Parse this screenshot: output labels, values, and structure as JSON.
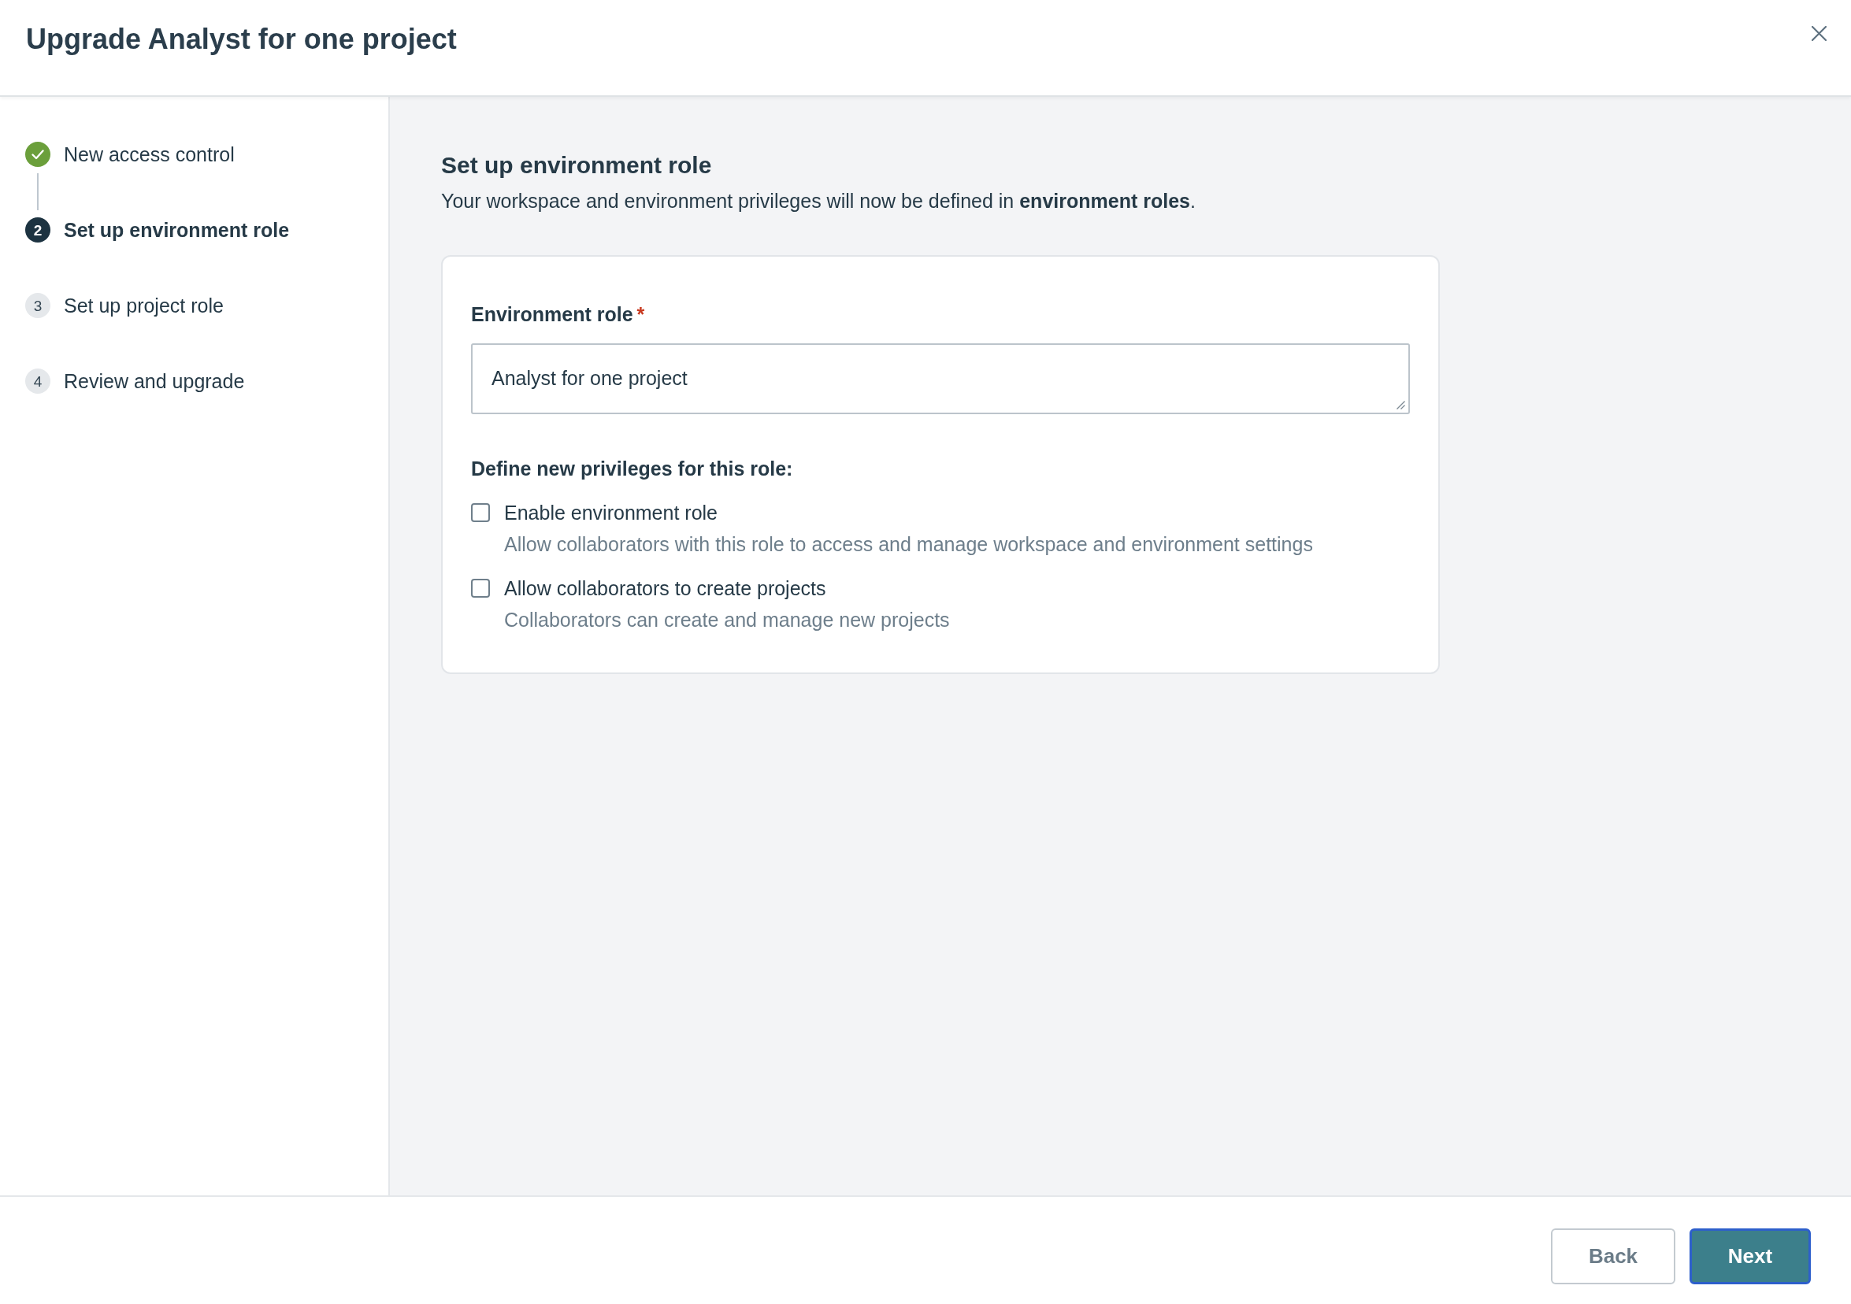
{
  "dialog": {
    "title": "Upgrade Analyst for one project"
  },
  "steps": [
    {
      "label": "New access control",
      "completed": true,
      "selected": false
    },
    {
      "number": "2",
      "label": "Set up environment role",
      "completed": false,
      "selected": true
    },
    {
      "number": "3",
      "label": "Set up project role",
      "completed": false,
      "selected": false
    },
    {
      "number": "4",
      "label": "Review and upgrade",
      "completed": false,
      "selected": false
    }
  ],
  "section": {
    "heading": "Set up environment role",
    "description": "Your workspace and environment privileges will now be defined in **environment roles**."
  },
  "form": {
    "role_field": {
      "label": "Environment role",
      "required_mark": "*",
      "value": "Analyst for one project"
    },
    "privileges_heading": "Define new privileges for this role:",
    "privileges": [
      {
        "label": "Enable environment role",
        "description": "Allow collaborators with this role to access and manage workspace and environment settings",
        "checked": false
      },
      {
        "label": "Allow collaborators to create projects",
        "description": "Collaborators can create and manage new projects",
        "checked": false
      }
    ]
  },
  "footer": {
    "buttons": [
      {
        "label": "Back",
        "kind": "secondary",
        "focused": false
      },
      {
        "label": "Next",
        "kind": "primary",
        "focused": true
      }
    ]
  }
}
